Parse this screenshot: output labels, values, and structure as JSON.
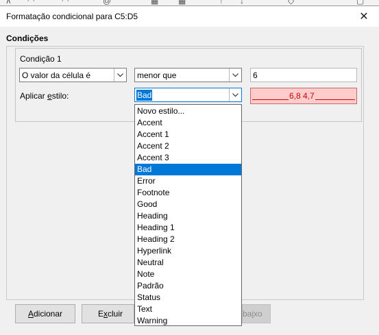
{
  "dialog": {
    "title": "Formatação condicional para C5:D5",
    "close_glyph": "✕",
    "section_label": "Condições"
  },
  "condition": {
    "label": "Condição 1",
    "cell_mode": "O valor da célula é",
    "operator": "menor que",
    "value": "6",
    "apply_style_pre": "Aplicar ",
    "apply_style_u": "e",
    "apply_style_post": "stilo:",
    "style_selected": "Bad",
    "preview_text": "6,8 4,7"
  },
  "dropdown": {
    "items": [
      "Novo estilo...",
      "Accent",
      "Accent 1",
      "Accent 2",
      "Accent 3",
      "Bad",
      "Error",
      "Footnote",
      "Good",
      "Heading",
      "Heading 1",
      "Heading 2",
      "Hyperlink",
      "Neutral",
      "Note",
      "Padrão",
      "Status",
      "Text",
      "Warning"
    ],
    "selected_index": 5
  },
  "buttons": {
    "add_u": "A",
    "add_rest": "dicionar",
    "delete_pre": "E",
    "delete_u": "x",
    "delete_post": "cluir",
    "down_pre": "",
    "down_visible": "ba",
    "down_u": "i",
    "down_post": "xo"
  },
  "colors": {
    "selection": "#0078d7",
    "preview_bg": "#ffcccc",
    "preview_text": "#cc0000"
  }
}
